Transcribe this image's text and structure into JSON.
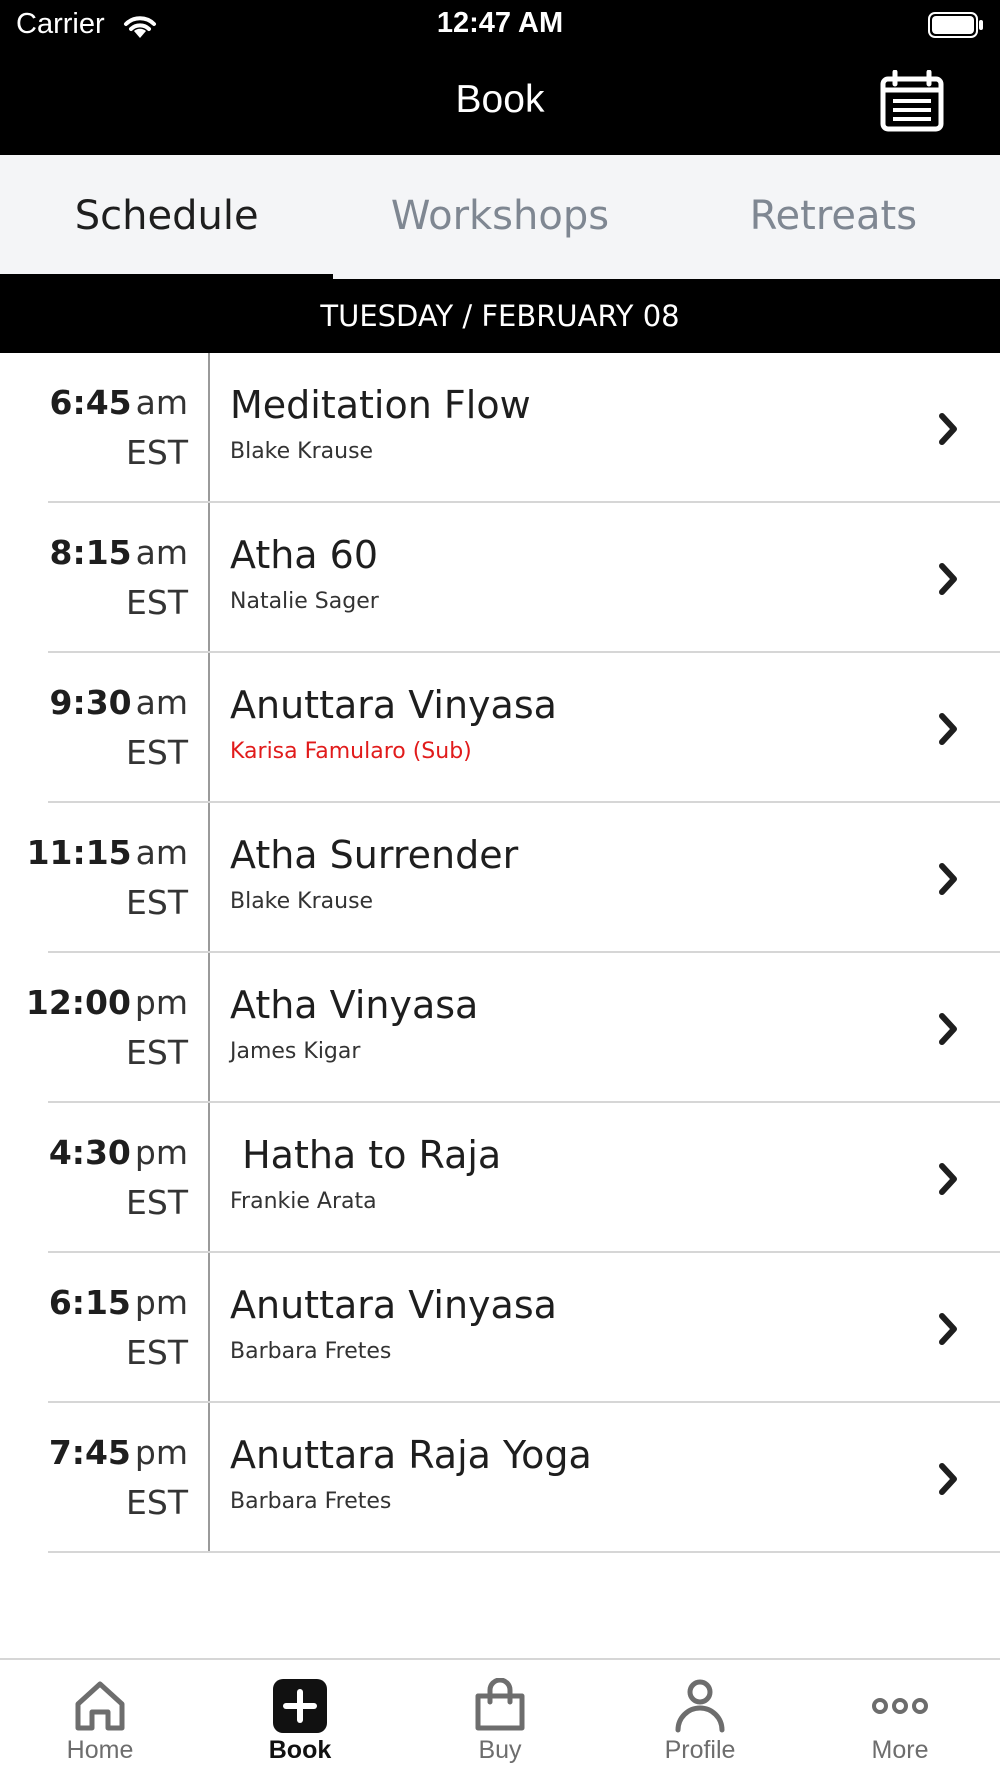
{
  "status_bar": {
    "carrier": "Carrier",
    "time": "12:47 AM"
  },
  "header": {
    "title": "Book",
    "calendar_icon": "calendar-icon"
  },
  "tabs": [
    {
      "label": "Schedule",
      "active": true
    },
    {
      "label": "Workshops",
      "active": false
    },
    {
      "label": "Retreats",
      "active": false
    }
  ],
  "date_bar": "TUESDAY / FEBRUARY 08",
  "schedule": [
    {
      "time": "6:45",
      "ampm": "am",
      "tz": "EST",
      "name": "Meditation Flow",
      "instructor": "Blake Krause",
      "substitute": false
    },
    {
      "time": "8:15",
      "ampm": "am",
      "tz": "EST",
      "name": "Atha 60",
      "instructor": "Natalie Sager",
      "substitute": false
    },
    {
      "time": "9:30",
      "ampm": "am",
      "tz": "EST",
      "name": "Anuttara Vinyasa",
      "instructor": "Karisa Famularo (Sub)",
      "substitute": true
    },
    {
      "time": "11:15",
      "ampm": "am",
      "tz": "EST",
      "name": "Atha Surrender",
      "instructor": "Blake Krause",
      "substitute": false
    },
    {
      "time": "12:00",
      "ampm": "pm",
      "tz": "EST",
      "name": "Atha Vinyasa",
      "instructor": "James Kigar",
      "substitute": false
    },
    {
      "time": "4:30",
      "ampm": "pm",
      "tz": "EST",
      "name": " Hatha to Raja",
      "instructor": "Frankie Arata",
      "substitute": false
    },
    {
      "time": "6:15",
      "ampm": "pm",
      "tz": "EST",
      "name": "Anuttara Vinyasa",
      "instructor": "Barbara Fretes",
      "substitute": false
    },
    {
      "time": "7:45",
      "ampm": "pm",
      "tz": "EST",
      "name": "Anuttara Raja Yoga",
      "instructor": "Barbara Fretes",
      "substitute": false
    }
  ],
  "bottom_nav": [
    {
      "label": "Home",
      "icon": "home-icon",
      "active": false
    },
    {
      "label": "Book",
      "icon": "plus-icon",
      "active": true
    },
    {
      "label": "Buy",
      "icon": "shopping-bag-icon",
      "active": false
    },
    {
      "label": "Profile",
      "icon": "person-icon",
      "active": false
    },
    {
      "label": "More",
      "icon": "more-icon",
      "active": false
    }
  ],
  "colors": {
    "header_bg": "#000000",
    "tab_bg": "#f4f5f7",
    "sub_instructor": "#e11b1b",
    "inactive_text": "#7f8792"
  }
}
